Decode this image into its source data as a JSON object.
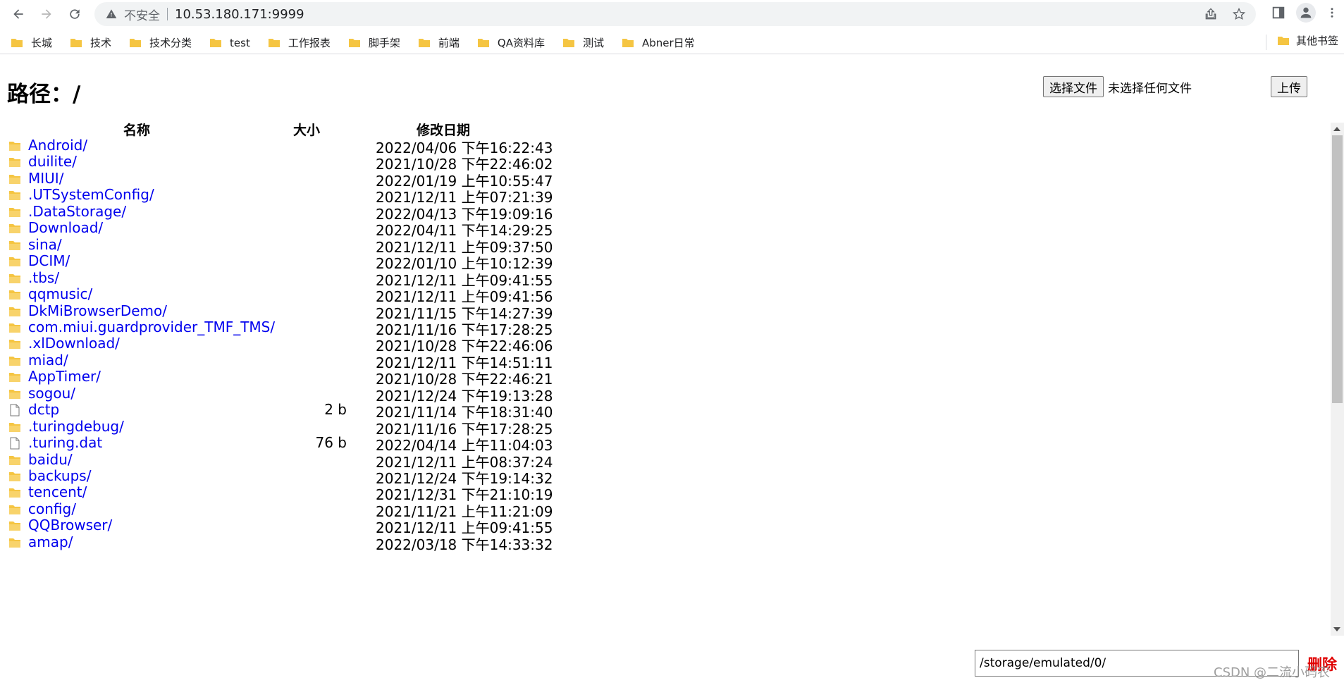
{
  "browser": {
    "security_label": "不安全",
    "url": "10.53.180.171:9999"
  },
  "bookmarks": [
    {
      "label": "长城"
    },
    {
      "label": "技术"
    },
    {
      "label": "技术分类"
    },
    {
      "label": "test"
    },
    {
      "label": "工作报表"
    },
    {
      "label": "脚手架"
    },
    {
      "label": "前端"
    },
    {
      "label": "QA资料库"
    },
    {
      "label": "测试"
    },
    {
      "label": "Abner日常"
    }
  ],
  "other_bookmarks": "其他书签",
  "page": {
    "title": "路径：/",
    "choose_file_label": "选择文件",
    "no_file_label": "未选择任何文件",
    "upload_label": "上传",
    "columns": {
      "name": "名称",
      "size": "大小",
      "modified": "修改日期"
    },
    "files": [
      {
        "name": "Android/",
        "size": "",
        "modified": "2022/04/06 下午16:22:43",
        "type": "folder"
      },
      {
        "name": "duilite/",
        "size": "",
        "modified": "2021/10/28 下午22:46:02",
        "type": "folder"
      },
      {
        "name": "MIUI/",
        "size": "",
        "modified": "2022/01/19 上午10:55:47",
        "type": "folder"
      },
      {
        "name": ".UTSystemConfig/",
        "size": "",
        "modified": "2021/12/11 上午07:21:39",
        "type": "folder"
      },
      {
        "name": ".DataStorage/",
        "size": "",
        "modified": "2022/04/13 下午19:09:16",
        "type": "folder"
      },
      {
        "name": "Download/",
        "size": "",
        "modified": "2022/04/11 下午14:29:25",
        "type": "folder"
      },
      {
        "name": "sina/",
        "size": "",
        "modified": "2021/12/11 上午09:37:50",
        "type": "folder"
      },
      {
        "name": "DCIM/",
        "size": "",
        "modified": "2022/01/10 上午10:12:39",
        "type": "folder"
      },
      {
        "name": ".tbs/",
        "size": "",
        "modified": "2021/12/11 上午09:41:55",
        "type": "folder"
      },
      {
        "name": "qqmusic/",
        "size": "",
        "modified": "2021/12/11 上午09:41:56",
        "type": "folder"
      },
      {
        "name": "DkMiBrowserDemo/",
        "size": "",
        "modified": "2021/11/15 下午14:27:39",
        "type": "folder"
      },
      {
        "name": "com.miui.guardprovider_TMF_TMS/",
        "size": "",
        "modified": "2021/11/16 下午17:28:25",
        "type": "folder"
      },
      {
        "name": ".xlDownload/",
        "size": "",
        "modified": "2021/10/28 下午22:46:06",
        "type": "folder"
      },
      {
        "name": "miad/",
        "size": "",
        "modified": "2021/12/11 下午14:51:11",
        "type": "folder"
      },
      {
        "name": "AppTimer/",
        "size": "",
        "modified": "2021/10/28 下午22:46:21",
        "type": "folder"
      },
      {
        "name": "sogou/",
        "size": "",
        "modified": "2021/12/24 下午19:13:28",
        "type": "folder"
      },
      {
        "name": "dctp",
        "size": "2 b",
        "modified": "2021/11/14 下午18:31:40",
        "type": "file"
      },
      {
        "name": ".turingdebug/",
        "size": "",
        "modified": "2021/11/16 下午17:28:25",
        "type": "folder"
      },
      {
        "name": ".turing.dat",
        "size": "76 b",
        "modified": "2022/04/14 上午11:04:03",
        "type": "file"
      },
      {
        "name": "baidu/",
        "size": "",
        "modified": "2021/12/11 上午08:37:24",
        "type": "folder"
      },
      {
        "name": "backups/",
        "size": "",
        "modified": "2021/12/24 下午19:14:32",
        "type": "folder"
      },
      {
        "name": "tencent/",
        "size": "",
        "modified": "2021/12/31 下午21:10:19",
        "type": "folder"
      },
      {
        "name": "config/",
        "size": "",
        "modified": "2021/11/21 上午11:21:09",
        "type": "folder"
      },
      {
        "name": "QQBrowser/",
        "size": "",
        "modified": "2021/12/11 上午09:41:55",
        "type": "folder"
      },
      {
        "name": "amap/",
        "size": "",
        "modified": "2022/03/18 下午14:33:32",
        "type": "folder"
      }
    ],
    "path_value": "/storage/emulated/0/",
    "delete_label": "删除"
  },
  "watermark": "CSDN @二流小码农",
  "colors": {
    "link": "#0000ee",
    "folder": "#f5c542",
    "delete": "#e00000"
  },
  "icons": {
    "folder": "folder-icon",
    "file": "file-icon"
  }
}
